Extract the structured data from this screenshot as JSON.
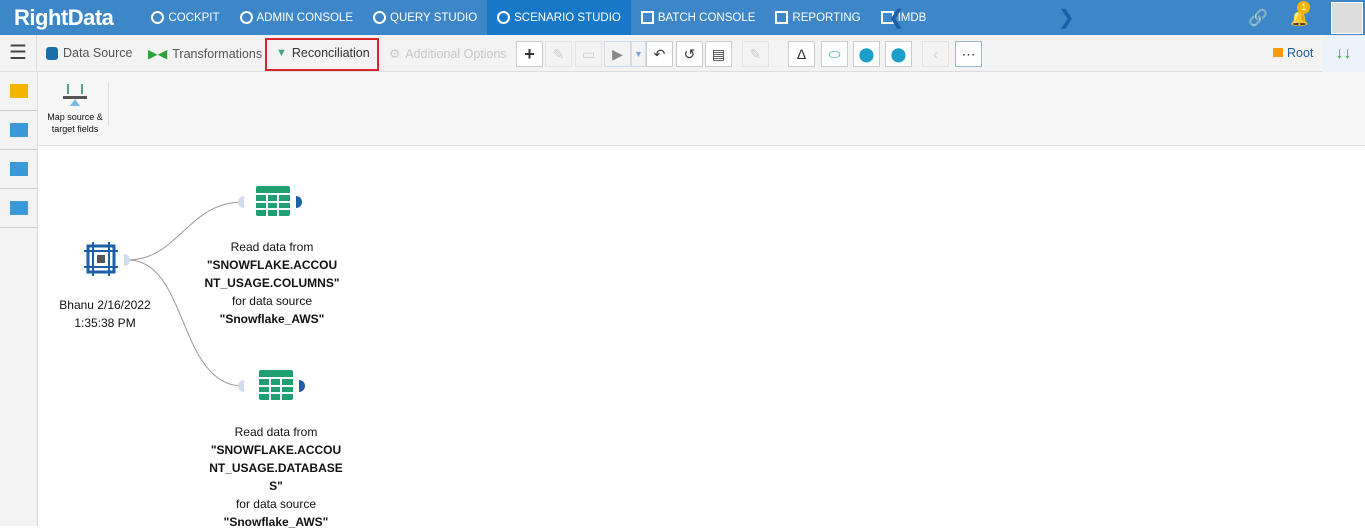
{
  "app": {
    "logo": "RightData"
  },
  "nav": [
    "COCKPIT",
    "ADMIN CONSOLE",
    "QUERY STUDIO",
    "SCENARIO STUDIO",
    "BATCH CONSOLE",
    "REPORTING",
    "IMDB"
  ],
  "notifications": {
    "count": "1"
  },
  "toolbar": {
    "data_source": "Data Source",
    "transformations": "Transformations",
    "reconciliation": "Reconciliation",
    "additional_options": "Additional Options",
    "root": "Root"
  },
  "ribbon": {
    "map_fields": "Map source & target fields"
  },
  "nodes": {
    "start": {
      "line1": "Bhanu 2/16/2022",
      "line2": "1:35:38 PM"
    },
    "read1": {
      "prefix": "Read data from",
      "table": "\"SNOWFLAKE.ACCOUNT_USAGE.COLUMNS\"",
      "mid": "for data source",
      "source": "\"Snowflake_AWS\""
    },
    "read2": {
      "prefix": "Read data from",
      "table": "\"SNOWFLAKE.ACCOUNT_USAGE.DATABASES\"",
      "mid": "for data source",
      "source": "\"Snowflake_AWS\""
    }
  }
}
